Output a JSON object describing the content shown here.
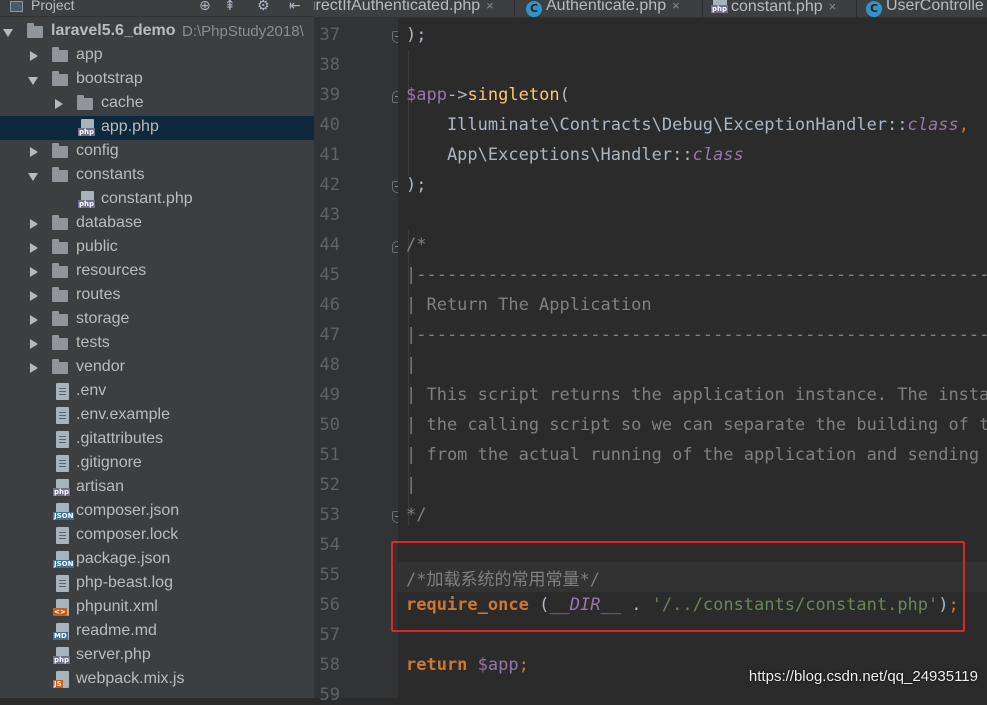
{
  "project_panel": {
    "title": "Project",
    "toolbar_icons": [
      "target-icon",
      "collapse-icon",
      "gear-icon",
      "hide-icon"
    ],
    "tree": [
      {
        "label": "laravel5.6_demo",
        "hint": "D:\\PhpStudy2018\\",
        "kind": "folder",
        "state": "open",
        "depth": 0,
        "bold": true
      },
      {
        "label": "app",
        "kind": "folder",
        "state": "closed",
        "depth": 1
      },
      {
        "label": "bootstrap",
        "kind": "folder",
        "state": "open",
        "depth": 1
      },
      {
        "label": "cache",
        "kind": "folder",
        "state": "closed",
        "depth": 2
      },
      {
        "label": "app.php",
        "kind": "php",
        "depth": 2,
        "selected": true
      },
      {
        "label": "config",
        "kind": "folder",
        "state": "closed",
        "depth": 1
      },
      {
        "label": "constants",
        "kind": "folder",
        "state": "open",
        "depth": 1
      },
      {
        "label": "constant.php",
        "kind": "php",
        "depth": 2
      },
      {
        "label": "database",
        "kind": "folder",
        "state": "closed",
        "depth": 1
      },
      {
        "label": "public",
        "kind": "folder",
        "state": "closed",
        "depth": 1
      },
      {
        "label": "resources",
        "kind": "folder",
        "state": "closed",
        "depth": 1
      },
      {
        "label": "routes",
        "kind": "folder",
        "state": "closed",
        "depth": 1
      },
      {
        "label": "storage",
        "kind": "folder",
        "state": "closed",
        "depth": 1
      },
      {
        "label": "tests",
        "kind": "folder",
        "state": "closed",
        "depth": 1
      },
      {
        "label": "vendor",
        "kind": "folder",
        "state": "closed",
        "depth": 1
      },
      {
        "label": ".env",
        "kind": "txt",
        "depth": 1
      },
      {
        "label": ".env.example",
        "kind": "txt",
        "depth": 1
      },
      {
        "label": ".gitattributes",
        "kind": "txt",
        "depth": 1
      },
      {
        "label": ".gitignore",
        "kind": "txt",
        "depth": 1
      },
      {
        "label": "artisan",
        "kind": "php",
        "depth": 1
      },
      {
        "label": "composer.json",
        "kind": "json",
        "depth": 1
      },
      {
        "label": "composer.lock",
        "kind": "txt",
        "depth": 1
      },
      {
        "label": "package.json",
        "kind": "json",
        "depth": 1
      },
      {
        "label": "php-beast.log",
        "kind": "txt",
        "depth": 1
      },
      {
        "label": "phpunit.xml",
        "kind": "xml",
        "depth": 1
      },
      {
        "label": "readme.md",
        "kind": "md",
        "depth": 1
      },
      {
        "label": "server.php",
        "kind": "php",
        "depth": 1
      },
      {
        "label": "webpack.mix.js",
        "kind": "js",
        "depth": 1
      }
    ]
  },
  "tabs": [
    {
      "label": "irectIfAuthenticated.php",
      "icon": "php-file-icon"
    },
    {
      "label": "Authenticate.php",
      "icon": "class-icon"
    },
    {
      "label": "constant.php",
      "icon": "php-file-icon"
    },
    {
      "label": "UserControlle",
      "icon": "class-icon"
    }
  ],
  "editor": {
    "lines": [
      {
        "num": "37",
        "fold": "end",
        "tokens": [
          [
            "",
            ");"
          ]
        ]
      },
      {
        "num": "38",
        "tokens": []
      },
      {
        "num": "39",
        "fold": "start",
        "tokens": [
          [
            "c-var",
            "$app"
          ],
          [
            "",
            "->"
          ],
          [
            "c-func",
            "singleton"
          ],
          [
            "",
            "("
          ]
        ]
      },
      {
        "num": "40",
        "tokens": [
          [
            "",
            "    Illuminate\\Contracts\\Debug\\ExceptionHandler::"
          ],
          [
            "c-italic",
            "class"
          ],
          [
            "c-punct",
            ","
          ]
        ]
      },
      {
        "num": "41",
        "tokens": [
          [
            "",
            "    App\\Exceptions\\Handler::"
          ],
          [
            "c-italic",
            "class"
          ]
        ]
      },
      {
        "num": "42",
        "fold": "end",
        "tokens": [
          [
            "",
            ");"
          ]
        ]
      },
      {
        "num": "43",
        "tokens": []
      },
      {
        "num": "44",
        "fold": "start",
        "tokens": [
          [
            "c-comment",
            "/*"
          ]
        ]
      },
      {
        "num": "45",
        "tokens": [
          [
            "c-comment",
            "|--------------------------------------------------------------------------"
          ]
        ]
      },
      {
        "num": "46",
        "tokens": [
          [
            "c-comment",
            "| Return The Application"
          ]
        ]
      },
      {
        "num": "47",
        "tokens": [
          [
            "c-comment",
            "|--------------------------------------------------------------------------"
          ]
        ]
      },
      {
        "num": "48",
        "tokens": [
          [
            "c-comment",
            "|"
          ]
        ]
      },
      {
        "num": "49",
        "tokens": [
          [
            "c-comment",
            "| This script returns the application instance. The instan"
          ]
        ]
      },
      {
        "num": "50",
        "tokens": [
          [
            "c-comment",
            "| the calling script so we can separate the building of th"
          ]
        ]
      },
      {
        "num": "51",
        "tokens": [
          [
            "c-comment",
            "| from the actual running of the application and sending r"
          ]
        ]
      },
      {
        "num": "52",
        "tokens": [
          [
            "c-comment",
            "|"
          ]
        ]
      },
      {
        "num": "53",
        "fold": "end",
        "tokens": [
          [
            "c-comment",
            "*/"
          ]
        ]
      },
      {
        "num": "54",
        "tokens": []
      },
      {
        "num": "55",
        "current": true,
        "tokens": [
          [
            "c-comment",
            "/*加载系统的常用常量*/"
          ]
        ]
      },
      {
        "num": "56",
        "tokens": [
          [
            "c-keyword",
            "require_once"
          ],
          [
            "",
            " ("
          ],
          [
            "c-const",
            "__DIR__"
          ],
          [
            "",
            " . "
          ],
          [
            "c-string",
            "'/../constants/constant.php'"
          ],
          [
            "",
            ")"
          ],
          [
            "c-punct",
            ";"
          ]
        ]
      },
      {
        "num": "57",
        "tokens": []
      },
      {
        "num": "58",
        "tokens": [
          [
            "c-keyword",
            "return"
          ],
          [
            "",
            " "
          ],
          [
            "c-var",
            "$app"
          ],
          [
            "c-punct",
            ";"
          ]
        ]
      },
      {
        "num": "59",
        "tokens": []
      }
    ]
  },
  "watermark": "https://blog.csdn.net/qq_24935119",
  "colors": {
    "highlight_box": "#e0242a",
    "selection": "#0d293e",
    "editor_bg": "#2b2b2b"
  }
}
